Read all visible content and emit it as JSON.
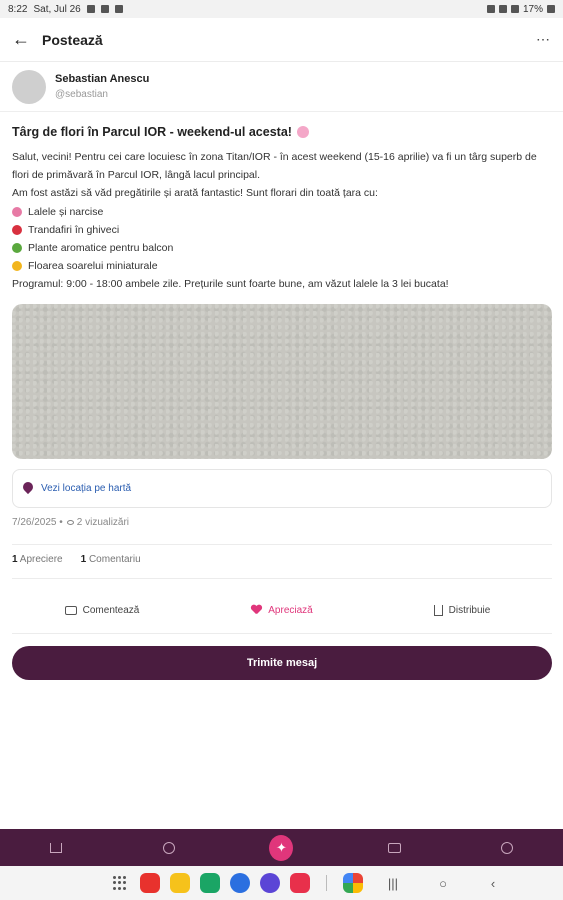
{
  "status_bar": {
    "time": "8:22",
    "date": "Sat, Jul 26",
    "battery": "17%"
  },
  "app_bar": {
    "title": "Postează"
  },
  "author": {
    "name": "Sebastian Anescu",
    "handle": "@sebastian"
  },
  "post": {
    "title": "Târg de flori în Parcul IOR - weekend-ul acesta!",
    "intro_1": "Salut, vecini! Pentru cei care locuiesc în zona Titan/IOR - în acest weekend (15-16 aprilie) va fi un târg superb de flori de primăvară în Parcul IOR, lângă lacul principal.",
    "intro_2": "Am fost astăzi să văd pregătirile și arată fantastic! Sunt florari din toată țara cu:",
    "items": [
      "Lalele și narcise",
      "Trandafiri în ghiveci",
      "Plante aromatice pentru balcon",
      "Floarea soarelui miniaturale"
    ],
    "schedule": "Programul: 9:00 - 18:00 ambele zile. Prețurile sunt foarte bune, am văzut lalele la 3 lei bucata!"
  },
  "location": {
    "label": "Vezi locația pe hartă"
  },
  "meta": {
    "date": "7/26/2025 •",
    "views": "2 vizualizări"
  },
  "stats": {
    "likes_count": "1",
    "likes_label": "Apreciere",
    "comments_count": "1",
    "comments_label": "Comentariu"
  },
  "actions": {
    "comment": "Comentează",
    "like": "Apreciază",
    "share": "Distribuie"
  },
  "send_button": "Trimite mesaj",
  "colors": {
    "brand": "#4a1c3f",
    "accent": "#e0367b",
    "link": "#2a5db0"
  }
}
